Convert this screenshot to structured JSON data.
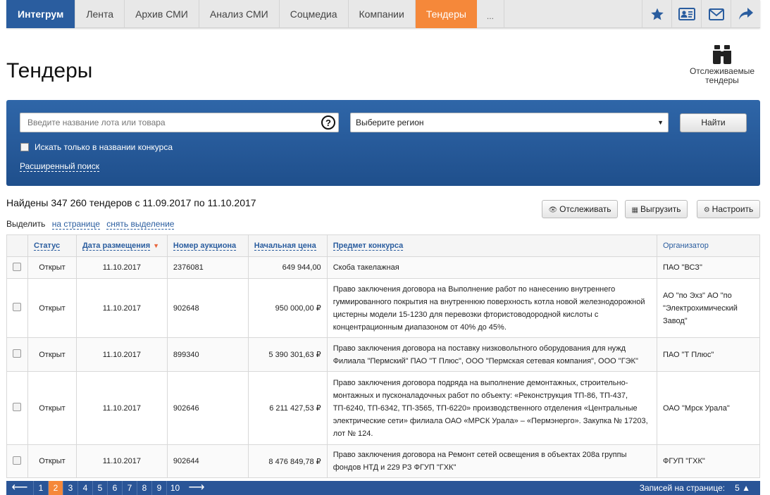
{
  "nav": {
    "brand": "Интегрум",
    "tabs": [
      "Лента",
      "Архив СМИ",
      "Анализ СМИ",
      "Соцмедиа",
      "Компании"
    ],
    "active": "Тендеры",
    "more": "...",
    "icons": [
      "star-icon",
      "contact-card-icon",
      "mail-icon",
      "share-icon"
    ]
  },
  "page": {
    "title": "Тендеры",
    "tracked_label": "Отслеживаемые тендеры"
  },
  "search": {
    "placeholder": "Введите название лота или товара",
    "help": "?",
    "region": "Выберите регион",
    "region_caret": "▼",
    "find_label": "Найти",
    "only_title_label": "Искать только в названии конкурса",
    "advanced_label": "Расширенный поиск"
  },
  "results": {
    "found_text": "Найдены 347 260 тендеров с 11.09.2017 по 11.10.2017",
    "select_label": "Выделить",
    "on_page": "на странице",
    "deselect": "снять выделение"
  },
  "actions": {
    "track": "Отслеживать",
    "export": "Выгрузить",
    "configure": "Настроить"
  },
  "table": {
    "headers": {
      "status": "Статус",
      "date": "Дата размещения",
      "number": "Номер аукциона",
      "price": "Начальная цена",
      "subject": "Предмет конкурса",
      "organizer": "Организатор"
    },
    "rows": [
      {
        "status": "Открыт",
        "date": "11.10.2017",
        "number": "2376081",
        "price": "649 944,00",
        "subject": "Скоба такелажная",
        "organizer": "ПАО \"ВСЗ\""
      },
      {
        "status": "Открыт",
        "date": "11.10.2017",
        "number": "902648",
        "price": "950 000,00 ₽",
        "subject": "Право заключения договора на Выполнение работ по нанесению внутреннего гуммированного покрытия на внутреннюю поверхность котла новой железнодорожной цистерны модели 15-1230 для перевозки фтористоводородной кислоты с концентрационным диапазоном от 40% до 45%.",
        "organizer": "АО \"по Эхз\" АО \"по \"Электрохимический Завод\""
      },
      {
        "status": "Открыт",
        "date": "11.10.2017",
        "number": "899340",
        "price": "5 390 301,63 ₽",
        "subject": "Право заключения договора на поставку низковольтного оборудования для нужд Филиала \"Пермский\" ПАО \"Т Плюс\", ООО \"Пермская сетевая компания\", ООО \"ГЭК\"",
        "organizer": "ПАО \"Т Плюс\""
      },
      {
        "status": "Открыт",
        "date": "11.10.2017",
        "number": "902646",
        "price": "6 211 427,53 ₽",
        "subject": "Право заключения договора подряда на выполнение демонтажных, строительно-монтажных и пусконаладочных работ по объекту: «Реконструкция ТП-86, ТП-437, ТП-6240, ТП-6342, ТП-3565, ТП-6220» производственного отделения «Центральные электрические сети» филиала ОАО «МРСК Урала» – «Пермэнерго». Закупка № 17203, лот № 124.",
        "organizer": "ОАО \"Мрск Урала\""
      },
      {
        "status": "Открыт",
        "date": "11.10.2017",
        "number": "902644",
        "price": "8 476 849,78 ₽",
        "subject": "Право заключения договора на Ремонт сетей освещения в объектах 208а группы фондов НТД и 229 РЗ ФГУП \"ГХК\"",
        "organizer": "ФГУП \"ГХК\""
      }
    ]
  },
  "pager": {
    "prev": "⟵",
    "next": "⟶",
    "pages": [
      "1",
      "2",
      "3",
      "4",
      "5",
      "6",
      "7",
      "8",
      "9",
      "10"
    ],
    "current": "2",
    "per_page_label": "Записей на странице:",
    "per_page_value": "5 ▲"
  }
}
